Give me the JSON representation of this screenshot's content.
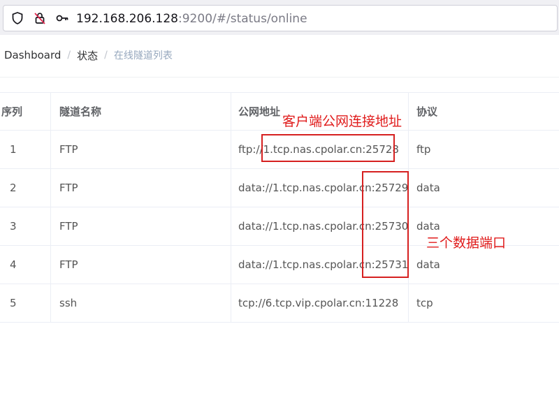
{
  "browser": {
    "url_host": "192.168.206.128",
    "url_rest": ":9200/#/status/online",
    "icons": [
      "shield-icon",
      "lock-crossed-icon",
      "key-icon"
    ]
  },
  "breadcrumb": {
    "items": [
      "Dashboard",
      "状态"
    ],
    "separator": "/",
    "current": "在线隧道列表"
  },
  "table": {
    "headers": [
      "序列",
      "隧道名称",
      "公网地址",
      "协议"
    ],
    "rows": [
      {
        "index": "1",
        "name": "FTP",
        "address": "ftp://1.tcp.nas.cpolar.cn:25728",
        "protocol": "ftp"
      },
      {
        "index": "2",
        "name": "FTP",
        "address": "data://1.tcp.nas.cpolar.cn:25729",
        "protocol": "data"
      },
      {
        "index": "3",
        "name": "FTP",
        "address": "data://1.tcp.nas.cpolar.cn:25730",
        "protocol": "data"
      },
      {
        "index": "4",
        "name": "FTP",
        "address": "data://1.tcp.nas.cpolar.cn:25731",
        "protocol": "data"
      },
      {
        "index": "5",
        "name": "ssh",
        "address": "tcp://6.tcp.vip.cpolar.cn:11228",
        "protocol": "tcp"
      }
    ]
  },
  "annotations": {
    "client_address": "客户端公网连接地址",
    "three_ports": "三个数据端口",
    "color": "#e01b1b"
  }
}
